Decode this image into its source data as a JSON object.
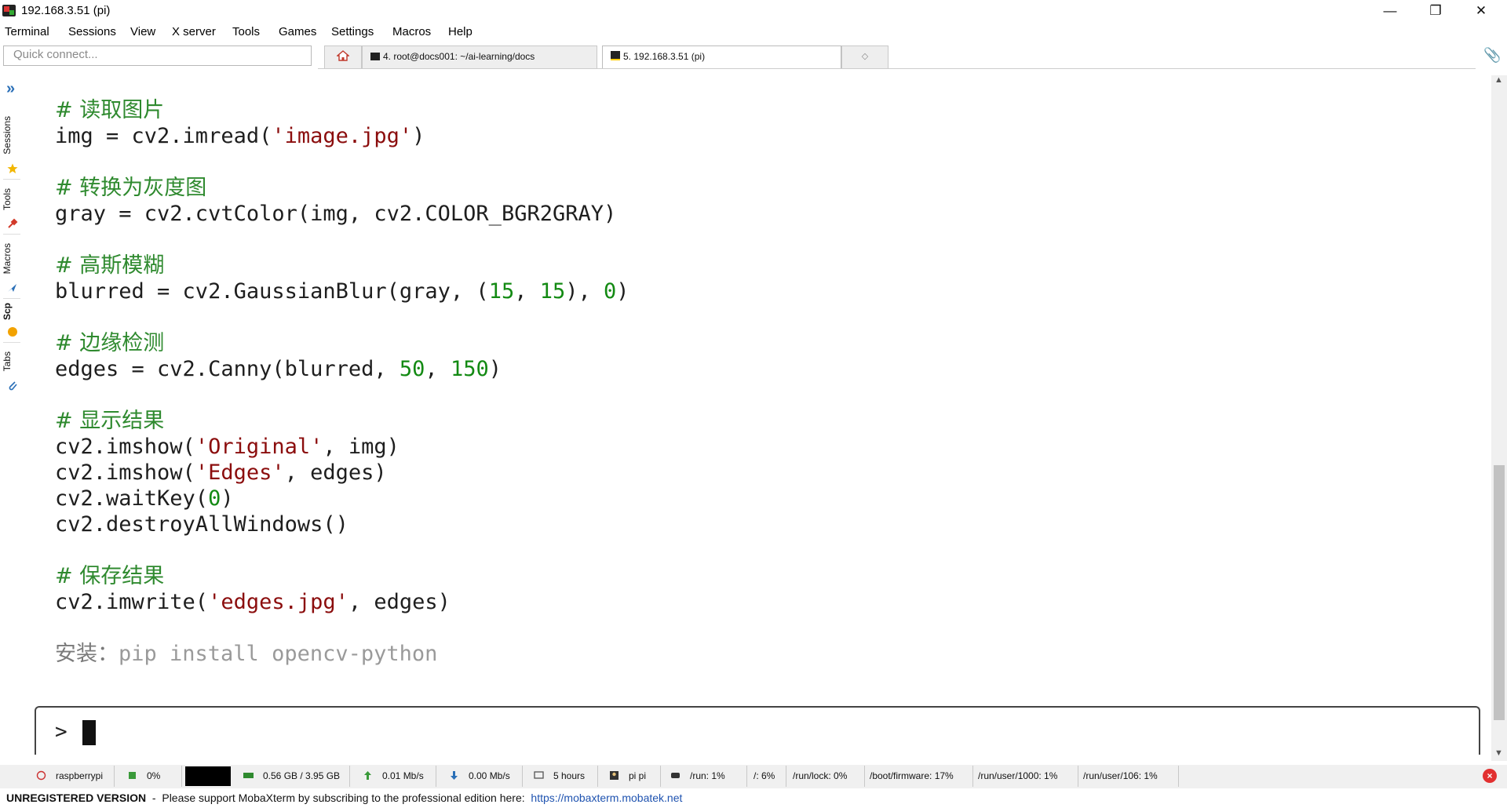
{
  "window": {
    "title": "192.168.3.51 (pi)",
    "controls": [
      "—",
      "❐",
      "✕"
    ]
  },
  "menu": [
    "Terminal",
    "Sessions",
    "View",
    "X server",
    "Tools",
    "Games",
    "Settings",
    "Macros",
    "Help"
  ],
  "quick_connect": {
    "placeholder": "Quick connect..."
  },
  "tabs": [
    {
      "label": "4. root@docs001: ~/ai-learning/docs"
    },
    {
      "label": "5. 192.168.3.51 (pi)"
    }
  ],
  "side_tabs": [
    "Sessions",
    "Tools",
    "Macros",
    "Scp",
    "Tabs"
  ],
  "terminal": {
    "lines": {
      "c1": "# 读取图片",
      "l1a": "img = cv2.imread(",
      "l1s": "'image.jpg'",
      "l1b": ")",
      "c2": "# 转换为灰度图",
      "l2": "gray = cv2.cvtColor(img, cv2.COLOR_BGR2GRAY)",
      "c3": "# 高斯模糊",
      "l3a": "blurred = cv2.GaussianBlur(gray, (",
      "l3n1": "15",
      "l3m": ", ",
      "l3n2": "15",
      "l3m2": "), ",
      "l3n3": "0",
      "l3b": ")",
      "c4": "# 边缘检测",
      "l4a": "edges = cv2.Canny(blurred, ",
      "l4n1": "50",
      "l4m": ", ",
      "l4n2": "150",
      "l4b": ")",
      "c5": "# 显示结果",
      "l5a": "cv2.imshow(",
      "l5s": "'Original'",
      "l5b": ", img)",
      "l6a": "cv2.imshow(",
      "l6s": "'Edges'",
      "l6b": ", edges)",
      "l7a": "cv2.waitKey(",
      "l7n": "0",
      "l7b": ")",
      "l8": "cv2.destroyAllWindows()",
      "c6": "# 保存结果",
      "l9a": "cv2.imwrite(",
      "l9s": "'edges.jpg'",
      "l9b": ", edges)",
      "install_label": "安装：",
      "install_cmd": "pip install opencv-python"
    },
    "prompt": ">"
  },
  "status": {
    "host": "raspberrypi",
    "cpu": "0%",
    "memory": "0.56 GB / 3.95 GB",
    "upload": "0.01 Mb/s",
    "download": "0.00 Mb/s",
    "uptime": "5 hours",
    "user": "pi  pi",
    "disks": [
      "/run: 1%",
      "/: 6%",
      "/run/lock: 0%",
      "/boot/firmware: 17%",
      "/run/user/1000: 1%",
      "/run/user/106: 1%"
    ]
  },
  "notice": {
    "bold": "UNREGISTERED VERSION",
    "text": "  -  Please support MobaXterm by subscribing to the professional edition here:  ",
    "link": "https://mobaxterm.mobatek.net"
  },
  "colors": {
    "comment": "#2f8a2f",
    "string": "#8b0d0d",
    "number": "#138a13",
    "accent": "#2a6fb7"
  }
}
